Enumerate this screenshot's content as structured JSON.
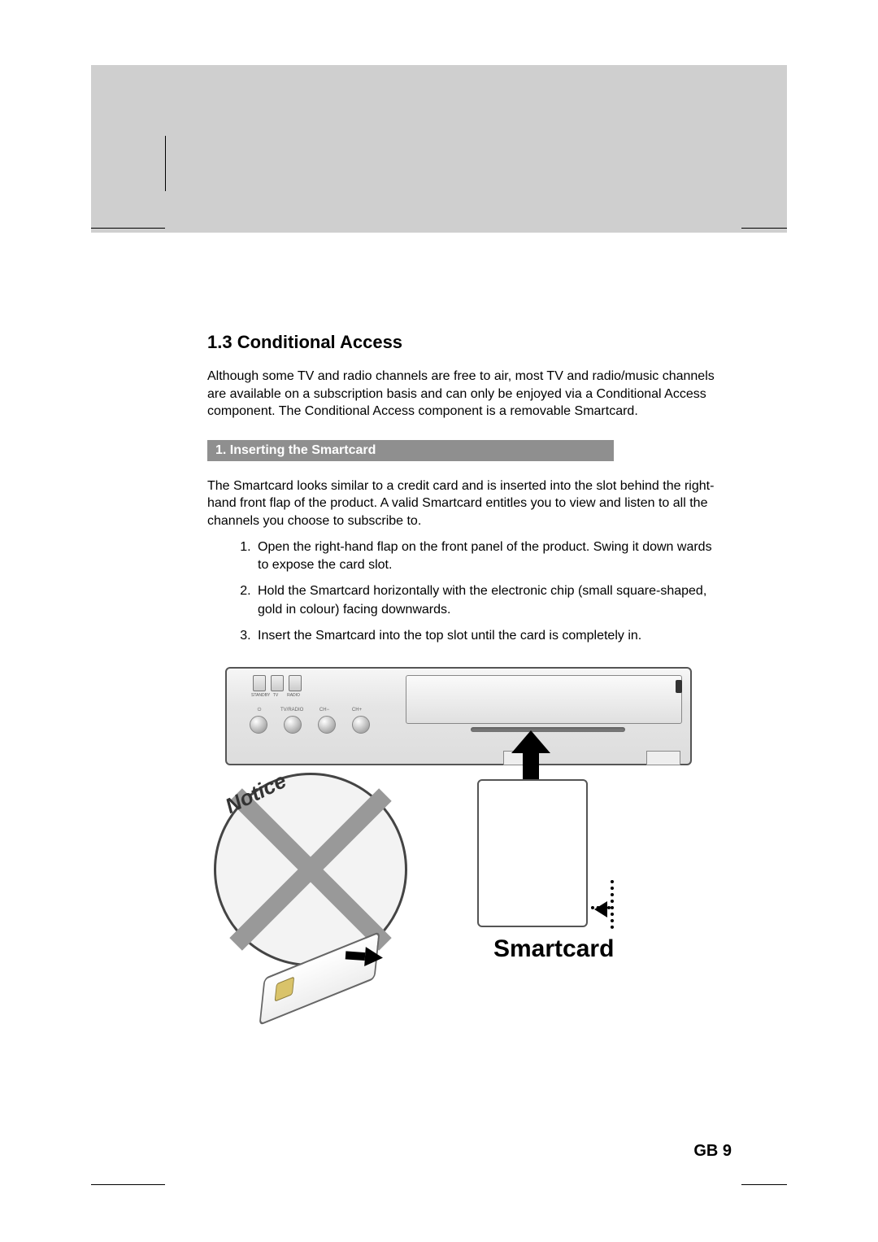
{
  "section": {
    "number": "1.3",
    "title": "Conditional Access",
    "heading": "1.3 Conditional Access",
    "intro": "Although some TV and radio channels are free to air, most TV and radio/music channels are available on a subscription basis and can only be enjoyed via a Conditional Access component. The Conditional Access component is a removable Smartcard."
  },
  "sub": {
    "number": "1.",
    "title": "Inserting the Smartcard",
    "heading": "1. Inserting the Smartcard",
    "lead": "The Smartcard looks similar to a credit card and is inserted into the slot behind the right-hand front flap of the product. A valid Smartcard entitles you to view and listen to all the channels you choose to subscribe to.",
    "steps": [
      "Open the right-hand flap on the front panel of the product. Swing it down wards to expose the card slot.",
      "Hold the Smartcard horizontally with the electronic chip (small square-shaped, gold in colour) facing downwards.",
      "Insert the Smartcard into the top slot until the card is completely in."
    ]
  },
  "figure": {
    "leds": [
      "STANDBY",
      "TV",
      "RADIO"
    ],
    "buttons": [
      "⏻",
      "TV/RADIO",
      "CH−",
      "CH+"
    ],
    "notice_label": "Notice",
    "card_label": "Smartcard"
  },
  "footer": {
    "page": "GB 9"
  }
}
